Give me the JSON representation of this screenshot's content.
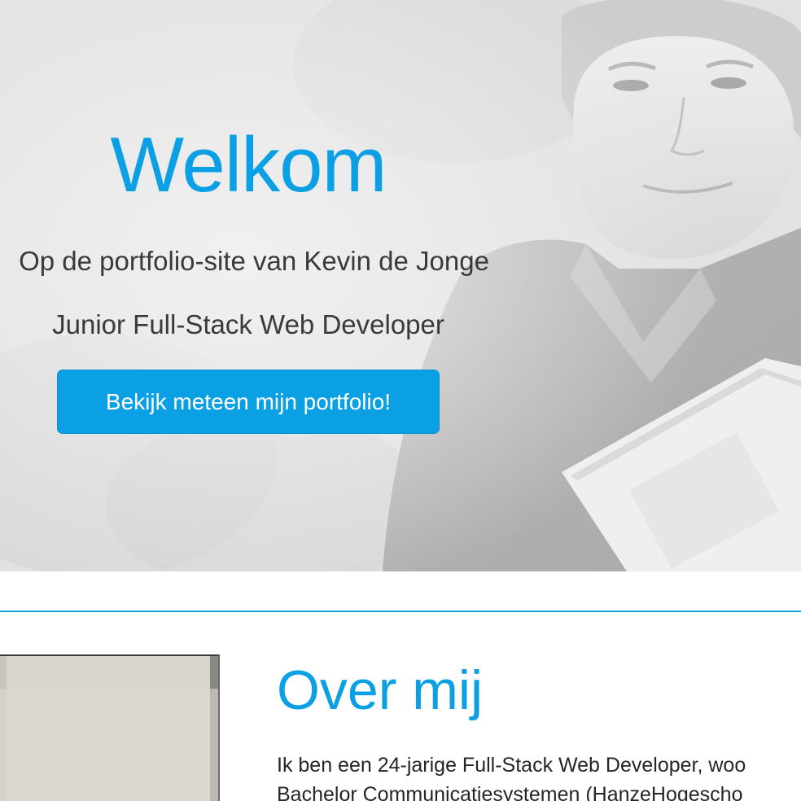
{
  "hero": {
    "title": "Welkom",
    "subtitle": "Op de portfolio-site van Kevin de Jonge",
    "role": "Junior Full-Stack Web Developer",
    "button_label": "Bekijk meteen mijn portfolio!"
  },
  "about": {
    "title": "Over mij",
    "lines": [
      "Ik ben een 24-jarige Full-Stack Web Developer, woo",
      "Bachelor Communicatiesystemen (HanzeHogescho"
    ]
  },
  "colors": {
    "accent": "#0aa0e3",
    "text": "#3a3a3a",
    "divider": "#1aa3df"
  }
}
